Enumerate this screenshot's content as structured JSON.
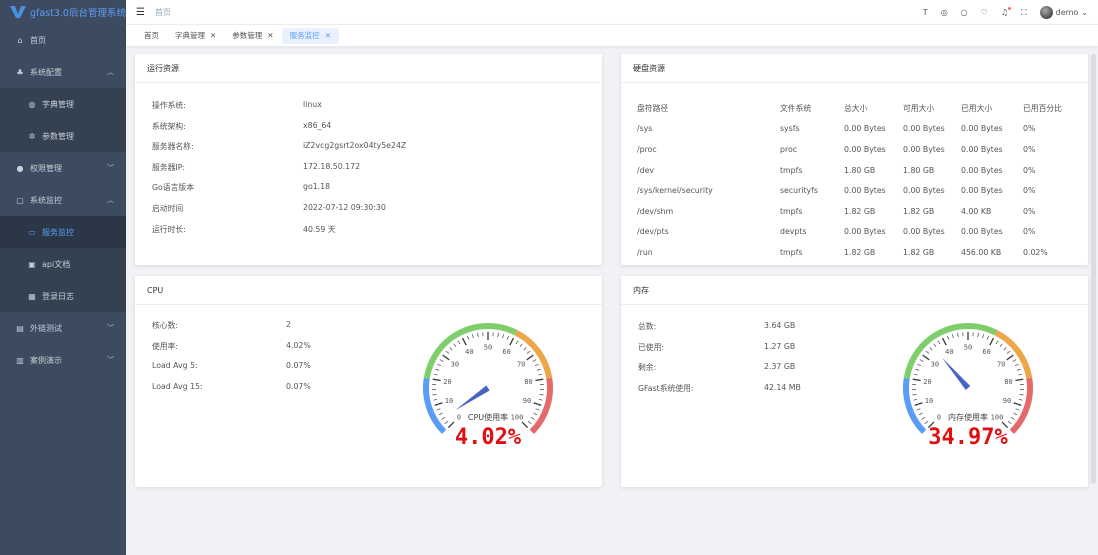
{
  "app": {
    "title": "gfast3.0后台管理系统"
  },
  "sidebar": {
    "items": [
      {
        "label": "首页",
        "icon": "home-icon",
        "type": "top"
      },
      {
        "label": "系统配置",
        "icon": "settings-icon",
        "type": "top",
        "chev": "^"
      },
      {
        "label": "字典管理",
        "icon": "dict-icon",
        "type": "sub"
      },
      {
        "label": "参数管理",
        "icon": "param-icon",
        "type": "sub"
      },
      {
        "label": "权限管理",
        "icon": "user-icon",
        "type": "top",
        "chev": "v"
      },
      {
        "label": "系统监控",
        "icon": "monitor-icon",
        "type": "top",
        "chev": "^"
      },
      {
        "label": "服务监控",
        "icon": "server-icon",
        "type": "sub",
        "active": true
      },
      {
        "label": "api文档",
        "icon": "doc-icon",
        "type": "sub"
      },
      {
        "label": "登录日志",
        "icon": "log-icon",
        "type": "sub"
      },
      {
        "label": "外链测试",
        "icon": "link-icon",
        "type": "top",
        "chev": "v"
      },
      {
        "label": "案例演示",
        "icon": "demo-icon",
        "type": "top",
        "chev": "v"
      }
    ]
  },
  "header": {
    "breadcrumb": "首页",
    "user": "demo"
  },
  "tabs": [
    {
      "label": "首页",
      "closable": false
    },
    {
      "label": "字典管理",
      "closable": true
    },
    {
      "label": "参数管理",
      "closable": true
    },
    {
      "label": "服务监控",
      "closable": true,
      "active": true
    }
  ],
  "runtime": {
    "title": "运行资源",
    "rows": [
      [
        "操作系统:",
        "linux"
      ],
      [
        "系统架构:",
        "x86_64"
      ],
      [
        "服务器名称:",
        "iZ2vcg2gsrt2ox04ty5e24Z"
      ],
      [
        "服务器IP:",
        "172.18.50.172"
      ],
      [
        "Go语言版本",
        "go1.18"
      ],
      [
        "启动时间",
        "2022-07-12 09:30:30"
      ],
      [
        "运行时长:",
        "40.59 天"
      ]
    ]
  },
  "disk": {
    "title": "硬盘资源",
    "headers": [
      "盘符路径",
      "文件系统",
      "总大小",
      "可用大小",
      "已用大小",
      "已用百分比"
    ],
    "rows": [
      [
        "/sys",
        "sysfs",
        "0.00 Bytes",
        "0.00 Bytes",
        "0.00 Bytes",
        "0%"
      ],
      [
        "/proc",
        "proc",
        "0.00 Bytes",
        "0.00 Bytes",
        "0.00 Bytes",
        "0%"
      ],
      [
        "/dev",
        "tmpfs",
        "1.80 GB",
        "1.80 GB",
        "0.00 Bytes",
        "0%"
      ],
      [
        "/sys/kernel/security",
        "securityfs",
        "0.00 Bytes",
        "0.00 Bytes",
        "0.00 Bytes",
        "0%"
      ],
      [
        "/dev/shm",
        "tmpfs",
        "1.82 GB",
        "1.82 GB",
        "4.00 KB",
        "0%"
      ],
      [
        "/dev/pts",
        "devpts",
        "0.00 Bytes",
        "0.00 Bytes",
        "0.00 Bytes",
        "0%"
      ],
      [
        "/run",
        "tmpfs",
        "1.82 GB",
        "1.82 GB",
        "456.00 KB",
        "0.02%"
      ]
    ]
  },
  "cpu": {
    "title": "CPU",
    "rows": [
      [
        "核心数:",
        "2"
      ],
      [
        "使用率:",
        "4.02%"
      ],
      [
        "Load Avg 5:",
        "0.07%"
      ],
      [
        "Load Avg 15:",
        "0.07%"
      ]
    ],
    "gauge": {
      "label": "CPU使用率",
      "value": 4.02,
      "display": "4.02%"
    }
  },
  "memory": {
    "title": "内存",
    "rows": [
      [
        "总数:",
        "3.64 GB"
      ],
      [
        "已使用:",
        "1.27 GB"
      ],
      [
        "剩余:",
        "2.37 GB"
      ],
      [
        "GFast系统使用:",
        "42.14 MB"
      ]
    ],
    "gauge": {
      "label": "内存使用率",
      "value": 34.97,
      "display": "34.97%"
    }
  },
  "gauge_colors": [
    "#5b9cf4",
    "#7ecf6b",
    "#eea64a",
    "#e26a6a"
  ],
  "value_color": "#e01010"
}
